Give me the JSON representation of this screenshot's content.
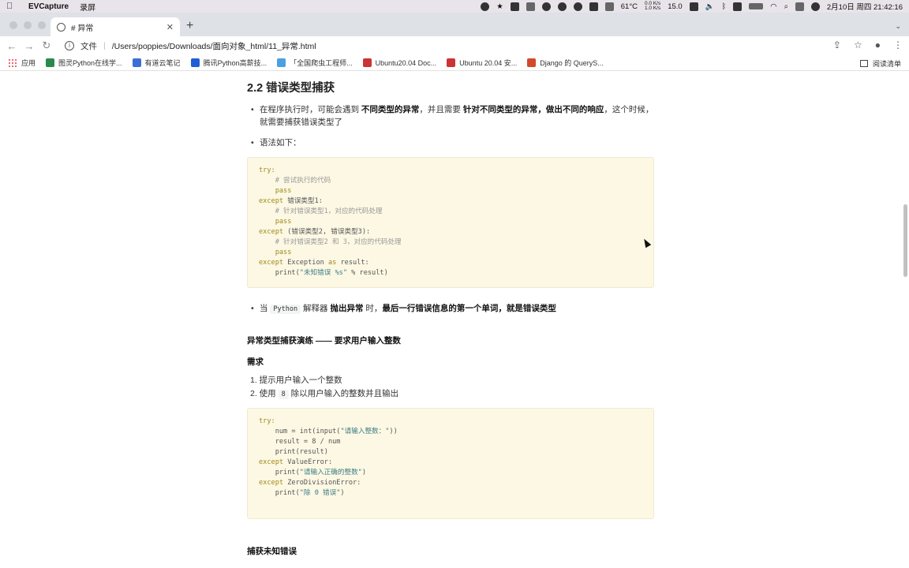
{
  "menubar": {
    "app_name": "EVCapture",
    "menu_item": "录屏",
    "temperature": "61°C",
    "net_up": "0.0 K/s",
    "net_down": "1.0 K/s",
    "speed": "15.0",
    "datetime": "2月10日 周四  21:42:16"
  },
  "browser": {
    "tab_title": "# 异常",
    "new_tab_symbol": "+",
    "address_scheme_label": "文件",
    "url": "/Users/poppies/Downloads/面向对象_html/11_异常.html",
    "bookmarks": [
      {
        "label": "应用",
        "color": "#e33"
      },
      {
        "label": "图灵Python在线学...",
        "color": "#2a8a4a"
      },
      {
        "label": "有道云笔记",
        "color": "#3b6fd6"
      },
      {
        "label": "腾讯Python高薪技...",
        "color": "#1e5fd8"
      },
      {
        "label": "「全国爬虫工程师...",
        "color": "#4aa0e0"
      },
      {
        "label": "Ubuntu20.04 Doc...",
        "color": "#c33"
      },
      {
        "label": "Ubuntu 20.04 安...",
        "color": "#c33"
      },
      {
        "label": "Django 的 QueryS...",
        "color": "#d24a2a"
      }
    ],
    "reading_list": "阅读清单"
  },
  "doc": {
    "heading": "2.2 错误类型捕获",
    "bullet1_a": "在程序执行时，可能会遇到 ",
    "bullet1_b": "不同类型的异常",
    "bullet1_c": "，并且需要 ",
    "bullet1_d": "针对不同类型的异常，做出不同的响应",
    "bullet1_e": "，这个时候，就需要捕获错误类型了",
    "bullet2": "语法如下：",
    "code1": [
      {
        "kw": "try:",
        "rest": ""
      },
      {
        "cm": "    # 尝试执行的代码"
      },
      {
        "kw": "    pass",
        "rest": ""
      },
      {
        "kw": "except",
        "rest": " 错误类型1:"
      },
      {
        "cm": "    # 针对错误类型1，对应的代码处理"
      },
      {
        "kw": "    pass",
        "rest": ""
      },
      {
        "kw": "except",
        "rest": " (错误类型2, 错误类型3):"
      },
      {
        "cm": "    # 针对错误类型2 和 3，对应的代码处理"
      },
      {
        "kw": "    pass",
        "rest": ""
      },
      {
        "kw": "except",
        "rest": " Exception ",
        "kw2": "as",
        "rest2": " result:"
      },
      {
        "pre": "    print(",
        "st": "\"未知错误 %s\"",
        "post": " % result)"
      }
    ],
    "bullet3_a": "当 ",
    "bullet3_code": "Python",
    "bullet3_b": " 解释器 ",
    "bullet3_c": "抛出异常",
    "bullet3_d": " 时，",
    "bullet3_e": "最后一行错误信息的第一个单词，就是错误类型",
    "practice_title": "异常类型捕获演练 —— 要求用户输入整数",
    "req_title": "需求",
    "req1": "1. 提示用户输入一个整数",
    "req2_a": "2. 使用 ",
    "req2_code": "8",
    "req2_b": " 除以用户输入的整数并且输出",
    "code2": [
      {
        "kw": "try:",
        "rest": ""
      },
      {
        "pre": "    num = int(input(",
        "st": "\"请输入整数：\"",
        "post": "))"
      },
      {
        "pre": "    result = 8 / num",
        "st": "",
        "post": ""
      },
      {
        "pre": "    print(result)",
        "st": "",
        "post": ""
      },
      {
        "kw": "except",
        "rest": " ValueError:"
      },
      {
        "pre": "    print(",
        "st": "\"请输入正确的整数\"",
        "post": ")"
      },
      {
        "kw": "except",
        "rest": " ZeroDivisionError:"
      },
      {
        "pre": "    print(",
        "st": "\"除 0 错误\"",
        "post": ")"
      }
    ],
    "unknown_title": "捕获未知错误"
  }
}
